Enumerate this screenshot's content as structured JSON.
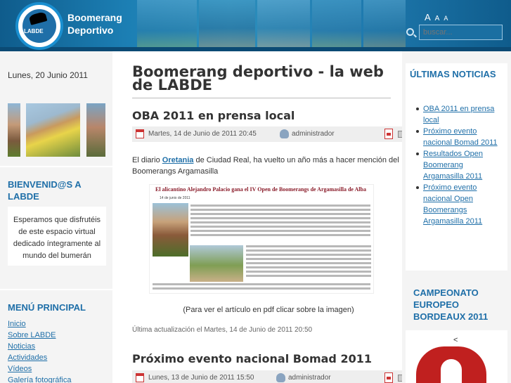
{
  "header": {
    "site_name_line1": "Boomerang",
    "site_name_line2": "Deportivo",
    "logo_text": "LABDE",
    "font_controls": [
      "A",
      "A",
      "A"
    ],
    "search_placeholder": "buscar..."
  },
  "left_sidebar": {
    "date": "Lunes, 20 Junio 2011",
    "welcome_title": "BIENVENID@S A LABDE",
    "welcome_text": "Esperamos que disfrutéis de este espacio virtual dedicado íntegramente al mundo del bumerán",
    "menu_title": "MENÚ PRINCIPAL",
    "menu_items": [
      "Inicio",
      "Sobre LABDE",
      "Noticias",
      "Actividades",
      "Vídeos",
      "Galería fotográfica"
    ]
  },
  "main": {
    "page_title": "Boomerang deportivo - la web de LABDE",
    "articles": [
      {
        "title": "OBA 2011 en prensa local",
        "date": "Martes, 14 de Junio de 2011 20:45",
        "author": "administrador",
        "body_prefix": "El diario ",
        "body_link": "Oretania",
        "body_suffix": " de Ciudad Real, ha vuelto un año más a hacer mención del Boomerangs Argamasilla",
        "clipping_title": "El alicantino Alejandro Palacio gana el IV Open de Boomerangs de Argamasilla de Alba",
        "clipping_date": "14 de junio de 2011",
        "caption": "(Para ver el artículo en pdf clicar sobre la imagen)",
        "updated": "Última actualización el Martes, 14 de Junio de 2011 20:50"
      },
      {
        "title": "Próximo evento nacional Bomad 2011",
        "date": "Lunes, 13 de Junio de 2011 15:50",
        "author": "administrador"
      }
    ]
  },
  "right_sidebar": {
    "latest_title": "ÚLTIMAS NOTICIAS",
    "latest_items": [
      "OBA 2011 en prensa local",
      "Próximo evento nacional Bomad 2011",
      "Resultados Open Boomerang Argamasilla 2011",
      "Próximo evento nacional Open Boomerangs Argamasilla 2011"
    ],
    "champ_title": "CAMPEONATO EUROPEO BORDEAUX 2011",
    "champ_arrow": "<"
  },
  "colors": {
    "header_blue": "#1c7fb4",
    "link_blue": "#1f6fa8",
    "sidebar_bg": "#f4f4f4"
  }
}
